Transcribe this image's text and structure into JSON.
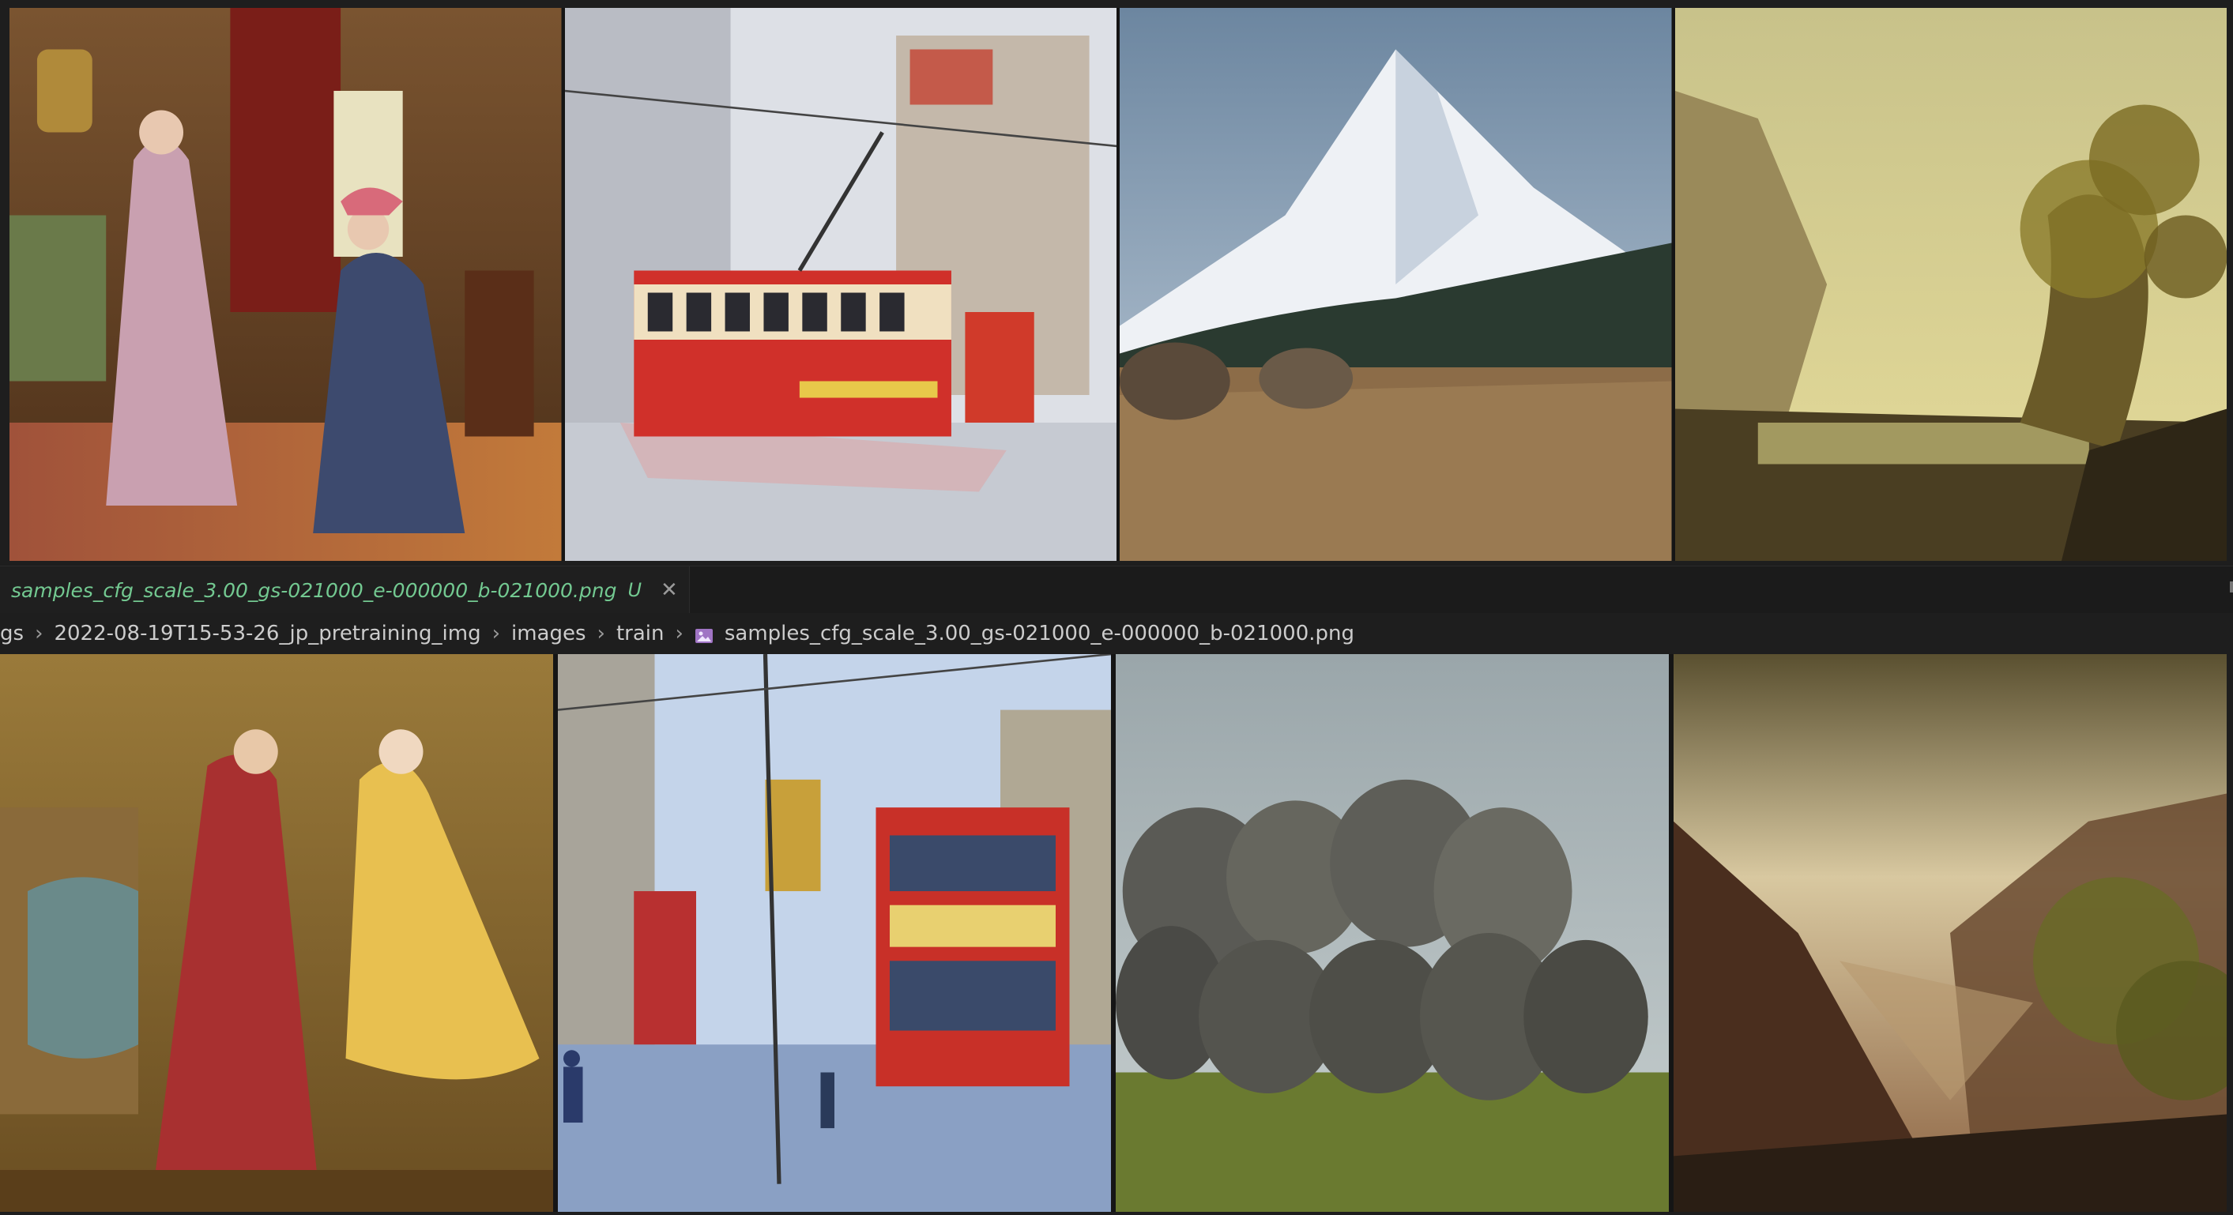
{
  "editor": {
    "tab": {
      "filename": "samples_cfg_scale_3.00_gs-021000_e-000000_b-021000.png",
      "status": "U",
      "close_icon": "close-icon"
    },
    "breadcrumb": {
      "items": [
        "gs",
        "2022-08-19T15-53-26_jp_pretraining_img",
        "images",
        "train"
      ],
      "file_icon": "image-file-icon",
      "file": "samples_cfg_scale_3.00_gs-021000_e-000000_b-021000.png"
    }
  },
  "image_grid": {
    "top_row": [
      {
        "subject": "two women in 18th century dresses in a parlor",
        "palette": [
          "#6b4a2a",
          "#c9a58a",
          "#8a2a22",
          "#3b4a6a"
        ]
      },
      {
        "subject": "red tram on a rainy city street",
        "palette": [
          "#d9dde3",
          "#c8322b",
          "#8a8f99",
          "#e8c85a"
        ]
      },
      {
        "subject": "snowy mountain with bison in grassland",
        "palette": [
          "#8fa6bd",
          "#f1f3f6",
          "#2f3f35",
          "#9a7a55"
        ]
      },
      {
        "subject": "golden valley landscape with trees",
        "palette": [
          "#c9c27a",
          "#7d6a3a",
          "#3a3420",
          "#e6e0a0"
        ]
      }
    ],
    "bottom_row": [
      {
        "subject": "two women in red and yellow dresses",
        "palette": [
          "#8a6a2a",
          "#b03a3a",
          "#e6c05a",
          "#5a8a8a"
        ]
      },
      {
        "subject": "watercolor city street with red trams",
        "palette": [
          "#a8c0e0",
          "#c8302a",
          "#4a6a9a",
          "#dfe6f0"
        ]
      },
      {
        "subject": "herd of grazing animals in misty field",
        "palette": [
          "#8a9aa0",
          "#5a5a55",
          "#7a8a3a",
          "#c8d0d0"
        ]
      },
      {
        "subject": "mountain valley at sunset with trees",
        "palette": [
          "#c8b890",
          "#5a3a2a",
          "#8a7a3a",
          "#2a2018"
        ]
      }
    ]
  }
}
